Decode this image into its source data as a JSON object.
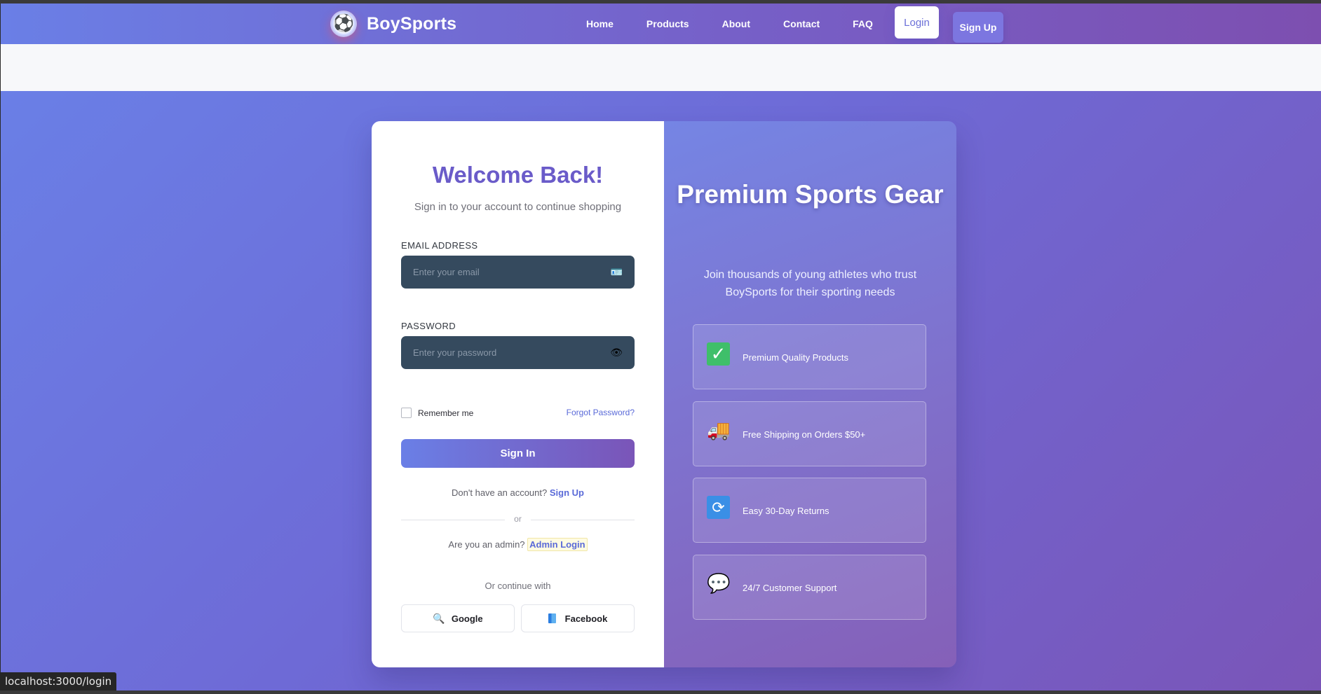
{
  "navbar": {
    "brand": "BoySports",
    "logo_icon": "soccer-ball-icon",
    "links": [
      "Home",
      "Products",
      "About",
      "Contact",
      "FAQ"
    ],
    "login_label": "Login",
    "signup_label": "Sign Up",
    "gradient_start": "#6a7fe6",
    "gradient_end": "#7d4fb0"
  },
  "login": {
    "title": "Welcome Back!",
    "subtitle": "Sign in to your account to continue shopping",
    "email_label": "EMAIL ADDRESS",
    "email_placeholder": "Enter your email",
    "email_value": "",
    "email_icon": "id-card-icon",
    "password_label": "PASSWORD",
    "password_placeholder": "Enter your password",
    "password_value": "",
    "password_icon": "eye-icon",
    "remember_label": "Remember me",
    "remember_checked": false,
    "forgot_label": "Forgot Password?",
    "signin_label": "Sign In",
    "no_account_text": "Don't have an account?",
    "signup_link": "Sign Up",
    "or_text": "or",
    "admin_text": "Are you an admin?",
    "admin_link": "Admin Login",
    "continue_text": "Or continue with",
    "google_label": "Google",
    "facebook_label": "Facebook",
    "title_color": "#6a5bc9",
    "input_bg": "#354a5e"
  },
  "promo": {
    "title": "Premium Sports Gear",
    "subtitle": "Join thousands of young athletes who trust BoySports for their sporting needs",
    "features": [
      {
        "icon": "check-mark-icon",
        "label": "Premium Quality Products"
      },
      {
        "icon": "delivery-truck-icon",
        "label": "Free Shipping on Orders $50+"
      },
      {
        "icon": "refresh-arrows-icon",
        "label": "Easy 30-Day Returns"
      },
      {
        "icon": "speech-bubble-icon",
        "label": "24/7 Customer Support"
      }
    ]
  },
  "status_bar": {
    "url": "localhost:3000/login"
  }
}
